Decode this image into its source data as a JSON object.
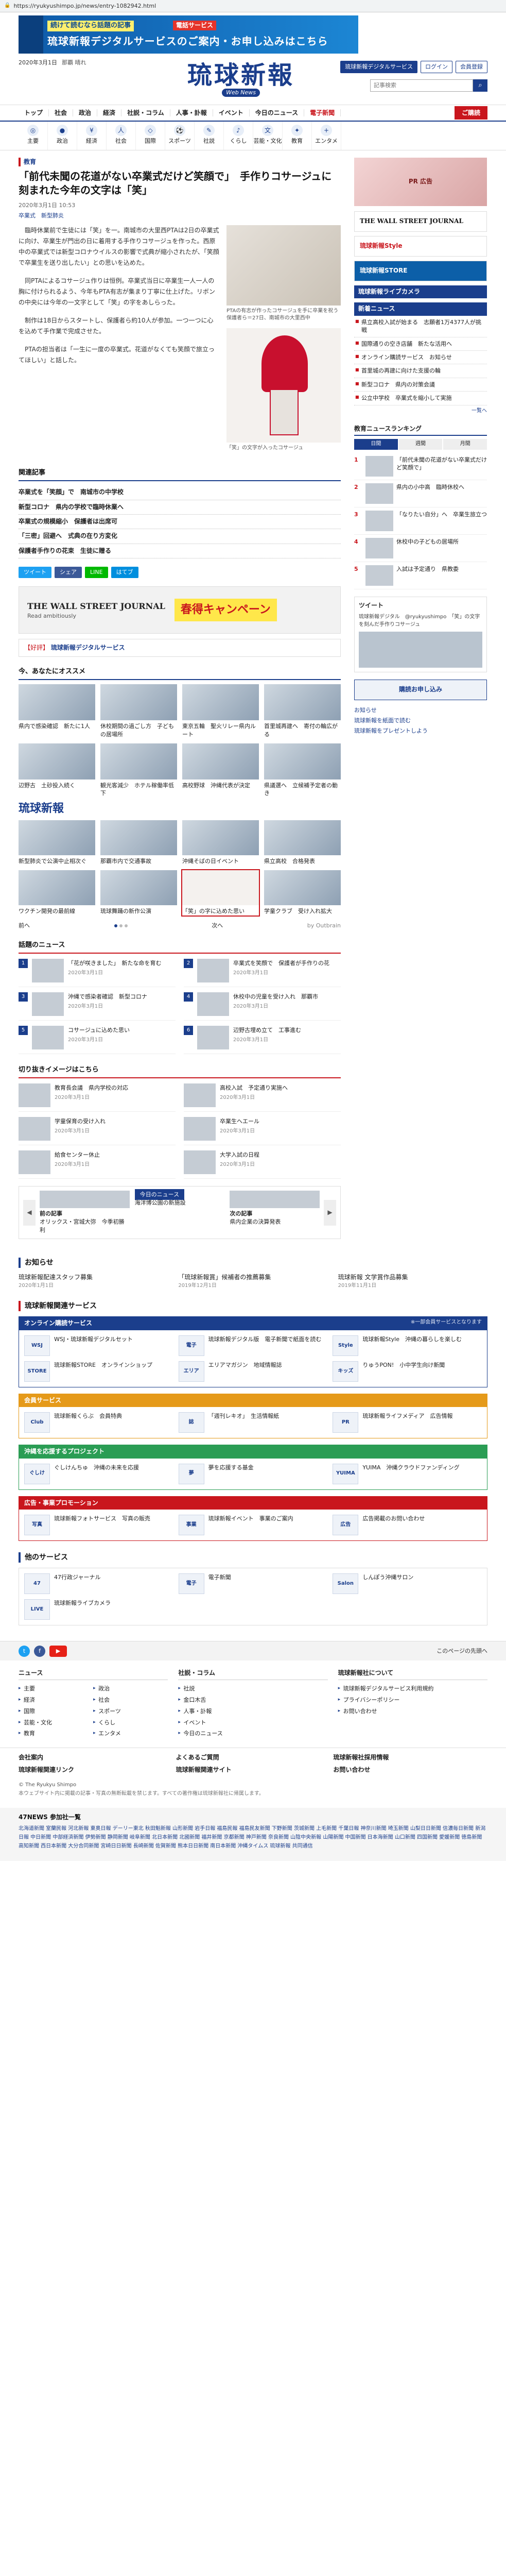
{
  "browser": {
    "url": "https://ryukyushimpo.jp/news/entry-1082942.html"
  },
  "banner": {
    "line1": "続けて読むなら話題の記事",
    "line2": "電話サービス",
    "line3": "琉球新報デジタルサービスのご案内・お申し込みはこちら"
  },
  "header": {
    "date": "2020年3月1日",
    "weather": "那覇 晴れ",
    "logo_jp": "琉球新報",
    "logo_en": "Web News",
    "btn_digital": "琉球新報デジタルサービス",
    "btn_login": "ログイン",
    "btn_register": "会員登録",
    "search_placeholder": "記事検索"
  },
  "gnav": [
    "トップ",
    "社会",
    "政治",
    "経済",
    "社説・コラム",
    "人事・訃報",
    "イベント",
    "今日のニュース",
    "電子新聞"
  ],
  "gnav_sub": "ご購読",
  "cnav": [
    {
      "icon": "◎",
      "label": "主要"
    },
    {
      "icon": "●",
      "label": "政治"
    },
    {
      "icon": "¥",
      "label": "経済"
    },
    {
      "icon": "人",
      "label": "社会"
    },
    {
      "icon": "◇",
      "label": "国際"
    },
    {
      "icon": "⚽",
      "label": "スポーツ"
    },
    {
      "icon": "✎",
      "label": "社説"
    },
    {
      "icon": "♪",
      "label": "くらし"
    },
    {
      "icon": "文",
      "label": "芸能・文化"
    },
    {
      "icon": "✦",
      "label": "教育"
    },
    {
      "icon": "+",
      "label": "エンタメ"
    }
  ],
  "article": {
    "category": "教育",
    "title": "「前代未聞の花道がない卒業式だけど笑顔で」　手作りコサージュに刻まれた今年の文字は「笑」",
    "date": "2020年3月1日 10:53",
    "tags": "卒業式　新型肺炎",
    "paragraphs": [
      "臨時休業前で生徒には「笑」を一。南城市の大里西PTAは2日の卒業式に向け、卒業生が門出の日に着用する手作りコサージュを作った。西原中の卒業式では新型コロナウイルスの影響で式典が縮小されたが、「笑顔で卒業生を送り出したい」との思いを込めた。",
      "同PTAによるコサージュ作りは恒例。卒業式当日に卒業生一人一人の胸に付けられるよう、今年もPTA有志が集まり丁寧に仕上げた。リボンの中央には今年の一文字として「笑」の字をあしらった。",
      "制作は18日からスタートし、保護者ら約10人が参加。一つ一つに心を込めて手作業で完成させた。",
      "PTAの担当者は「一生に一度の卒業式。花道がなくても笑顔で旅立ってほしい」と話した。"
    ],
    "img1_caption": "PTAの有志が作ったコサージュを手に卒業を祝う保護者ら＝27日、南城市の大里西中",
    "img2_caption": "「笑」の文字が入ったコサージュ"
  },
  "related": {
    "heading": "関連記事",
    "items": [
      "卒業式を「笑顔」で　南城市の中学校",
      "新型コロナ　県内の学校で臨時休業へ",
      "卒業式の規模縮小　保護者は出席可",
      "「三密」回避へ　式典の在り方変化",
      "保護者手作りの花束　生徒に贈る"
    ]
  },
  "sns": [
    {
      "label": "ツイート",
      "color": "#1da1f2"
    },
    {
      "label": "シェア",
      "color": "#3b5998"
    },
    {
      "label": "LINE",
      "color": "#00b900"
    },
    {
      "label": "はてブ",
      "color": "#008fde"
    }
  ],
  "ad_wsj": {
    "brand": "THE WALL STREET JOURNAL",
    "sub": "Read ambitiously",
    "promo": "春得キャンペーン"
  },
  "link_box": {
    "text": "琉球新報デジタルサービス",
    "red": "【好評】"
  },
  "recommend": {
    "heading": "今、あなたにオススメ",
    "cards": [
      "県内で感染確認　新たに1人",
      "休校期間の過ごし方　子どもの居場所",
      "東京五輪　聖火リレー県内ルート",
      "首里城再建へ　寄付の輪広がる",
      "辺野古　土砂投入続く",
      "観光客減少　ホテル稼働率低下",
      "高校野球　沖縄代表が決定",
      "県議選へ　立候補予定者の動き"
    ]
  },
  "ryukyu_list": {
    "cards": [
      "新型肺炎で公演中止相次ぐ",
      "那覇市内で交通事故",
      "沖縄そばの日イベント",
      "県立高校　合格発表",
      "ワクチン開発の最前線",
      "琉球舞踊の新作公演",
      "「笑」の字に込めた思い",
      "学童クラブ　受け入れ拡大"
    ],
    "pager_prev": "前へ",
    "pager_next": "次へ",
    "outbrain": "by Outbrain"
  },
  "rank_today": {
    "heading": "話題のニュース",
    "items": [
      {
        "t": "「花が咲きました」　新たな命を育む",
        "d": "2020年3月1日"
      },
      {
        "t": "卒業式を笑顔で　保護者が手作りの花",
        "d": "2020年3月1日"
      },
      {
        "t": "沖縄で感染者確認　新型コロナ",
        "d": "2020年3月1日"
      },
      {
        "t": "休校中の児童を受け入れ　那覇市",
        "d": "2020年3月1日"
      },
      {
        "t": "コサージュに込めた思い",
        "d": "2020年3月1日"
      },
      {
        "t": "辺野古埋め立て　工事進む",
        "d": "2020年3月1日"
      }
    ]
  },
  "rank_edu": {
    "heading": "切り抜きイメージはこちら",
    "items": [
      {
        "t": "教育長会議　県内学校の対応",
        "d": "2020年3月1日"
      },
      {
        "t": "高校入試　予定通り実施へ",
        "d": "2020年3月1日"
      },
      {
        "t": "学童保育の受け入れ",
        "d": "2020年3月1日"
      },
      {
        "t": "卒業生へエール",
        "d": "2020年3月1日"
      },
      {
        "t": "給食センター休止",
        "d": "2020年3月1日"
      },
      {
        "t": "大学入試の日程",
        "d": "2020年3月1日"
      }
    ]
  },
  "slider": {
    "prev": "前の記事",
    "next": "次の記事",
    "now": "今日のニュース",
    "items": [
      "オリックス・宮城大弥　今季初勝利",
      "海洋博公園の新施設",
      "県内企業の決算発表"
    ]
  },
  "notices": {
    "heading": "お知らせ",
    "items": [
      {
        "t": "琉球新報配達スタッフ募集",
        "d": "2020年1月1日"
      },
      {
        "t": "「琉球新報賞」候補者の推薦募集",
        "d": "2019年12月1日"
      },
      {
        "t": "琉球新報 文学賞作品募集",
        "d": "2019年11月1日"
      }
    ]
  },
  "services": {
    "heading": "琉球新報関連サービス",
    "boxes": [
      {
        "title": "オンライン購読サービス",
        "note": "※一部会員サービスとなります",
        "items": [
          {
            "ic": "WSJ",
            "t": "WSJ・琉球新報デジタルセット"
          },
          {
            "ic": "電子",
            "t": "琉球新報デジタル版　電子新聞で紙面を読む"
          },
          {
            "ic": "Style",
            "t": "琉球新報Style　沖縄の暮らしを楽しむ"
          },
          {
            "ic": "STORE",
            "t": "琉球新報STORE　オンラインショップ"
          },
          {
            "ic": "エリア",
            "t": "エリアマガジン　地域情報誌"
          },
          {
            "ic": "キッズ",
            "t": "りゅうPON!　小中学生向け新聞"
          }
        ]
      },
      {
        "title": "会員サービス",
        "note": "",
        "items": [
          {
            "ic": "Club",
            "t": "琉球新報くらぶ　会員特典"
          },
          {
            "ic": "誌",
            "t": "「週刊レキオ」　生活情報紙"
          },
          {
            "ic": "PR",
            "t": "琉球新報ライフメディア　広告情報"
          }
        ]
      },
      {
        "title": "沖縄を応援するプロジェクト",
        "note": "",
        "items": [
          {
            "ic": "ぐしけ",
            "t": "ぐしけんちゅ　沖縄の未来を応援"
          },
          {
            "ic": "夢",
            "t": "夢を応援する基金"
          },
          {
            "ic": "YUIMA",
            "t": "YUIMA　沖縄クラウドファンディング"
          }
        ]
      },
      {
        "title": "広告・事業プロモーション",
        "note": "",
        "items": [
          {
            "ic": "写真",
            "t": "琉球新報フォトサービス　写真の販売"
          },
          {
            "ic": "事業",
            "t": "琉球新報イベント　事業のご案内"
          },
          {
            "ic": "広告",
            "t": "広告掲載のお問い合わせ"
          }
        ]
      }
    ]
  },
  "others": {
    "heading": "他のサービス",
    "items": [
      {
        "ic": "47",
        "t": "47行政ジャーナル"
      },
      {
        "ic": "電子",
        "t": "電子新聞"
      },
      {
        "ic": "Salon",
        "t": "しんぽう沖縄サロン"
      },
      {
        "ic": "LIVE",
        "t": "琉球新報ライブカメラ"
      }
    ]
  },
  "footer": {
    "pagetop": "このページの先頭へ",
    "col1_h": "ニュース",
    "col1": [
      "主要",
      "政治",
      "経済",
      "社会",
      "国際",
      "スポーツ",
      "芸能・文化",
      "くらし",
      "教育",
      "エンタメ"
    ],
    "col2_h": "社説・コラム",
    "col2": [
      "社説",
      "金口木舌",
      "人事・訃報",
      "イベント",
      "今日のニュース"
    ],
    "col3_h": "琉球新報社について",
    "col3": [
      "琉球新報デジタルサービス利用規約",
      "プライバシーポリシー",
      "お問い合わせ"
    ],
    "bot": [
      "会社案内",
      "よくあるご質問",
      "琉球新報社採用情報",
      "琉球新報関連リンク",
      "琉球新報関連サイト",
      "お問い合わせ"
    ],
    "copyright": "© The Ryukyu Shimpo",
    "copy_note": "本ウェブサイト内に掲載の記事・写真の無断転載を禁じます。すべての著作権は琉球新報社に帰属します。"
  },
  "papers": {
    "heading": "47NEWS 参加社一覧",
    "text": "北海道新聞 室蘭民報 河北新報 東奥日報 デーリー東北 秋田魁新報 山形新聞 岩手日報 福島民報 福島民友新聞 下野新聞 茨城新聞 上毛新聞 千葉日報 神奈川新聞 埼玉新聞 山梨日日新聞 信濃毎日新聞 新潟日報 中日新聞 中部経済新聞 伊勢新聞 静岡新聞 岐阜新聞 北日本新聞 北國新聞 福井新聞 京都新聞 神戸新聞 奈良新聞 山陰中央新報 山陽新聞 中国新聞 日本海新聞 山口新聞 四国新聞 愛媛新聞 徳島新聞 高知新聞 西日本新聞 大分合同新聞 宮崎日日新聞 長崎新聞 佐賀新聞 熊本日日新聞 南日本新聞 沖縄タイムス 琉球新報 共同通信"
  },
  "right": {
    "ad": "PR 広告",
    "banners": [
      "THE WALL STREET JOURNAL",
      "琉球新報Style",
      "琉球新報STORE"
    ],
    "live_h": "琉球新報ライブカメラ",
    "news_h": "新着ニュース",
    "news": [
      "県立高校入試が始まる　志願者1万4377人が挑戦",
      "国際通りの空き店舗　新たな活用へ",
      "オンライン購読サービス　お知らせ",
      "首里城の再建に向けた支援の輪",
      "新型コロナ　県内の対策会議",
      "公立中学校　卒業式を縮小して実施"
    ],
    "more": "一覧へ",
    "rank_h": "教育ニュースランキング",
    "tabs": [
      "日間",
      "週間",
      "月間"
    ],
    "rank": [
      {
        "n": "1",
        "t": "「前代未聞の花道がない卒業式だけど笑顔で」"
      },
      {
        "n": "2",
        "t": "県内の小中高　臨時休校へ"
      },
      {
        "n": "3",
        "t": "「なりたい自分」へ　卒業生旅立つ"
      },
      {
        "n": "4",
        "t": "休校中の子どもの居場所"
      },
      {
        "n": "5",
        "t": "入試は予定通り　県教委"
      }
    ],
    "tw_h": "ツイート",
    "tw_b": "琉球新報デジタル　@ryukyushimpo　「笑」の文字を刻んだ手作りコサージュ",
    "sub_btn": "購読お申し込み",
    "lnks": [
      "お知らせ",
      "琉球新報を紙面で読む",
      "琉球新報をプレゼントしよう"
    ]
  }
}
